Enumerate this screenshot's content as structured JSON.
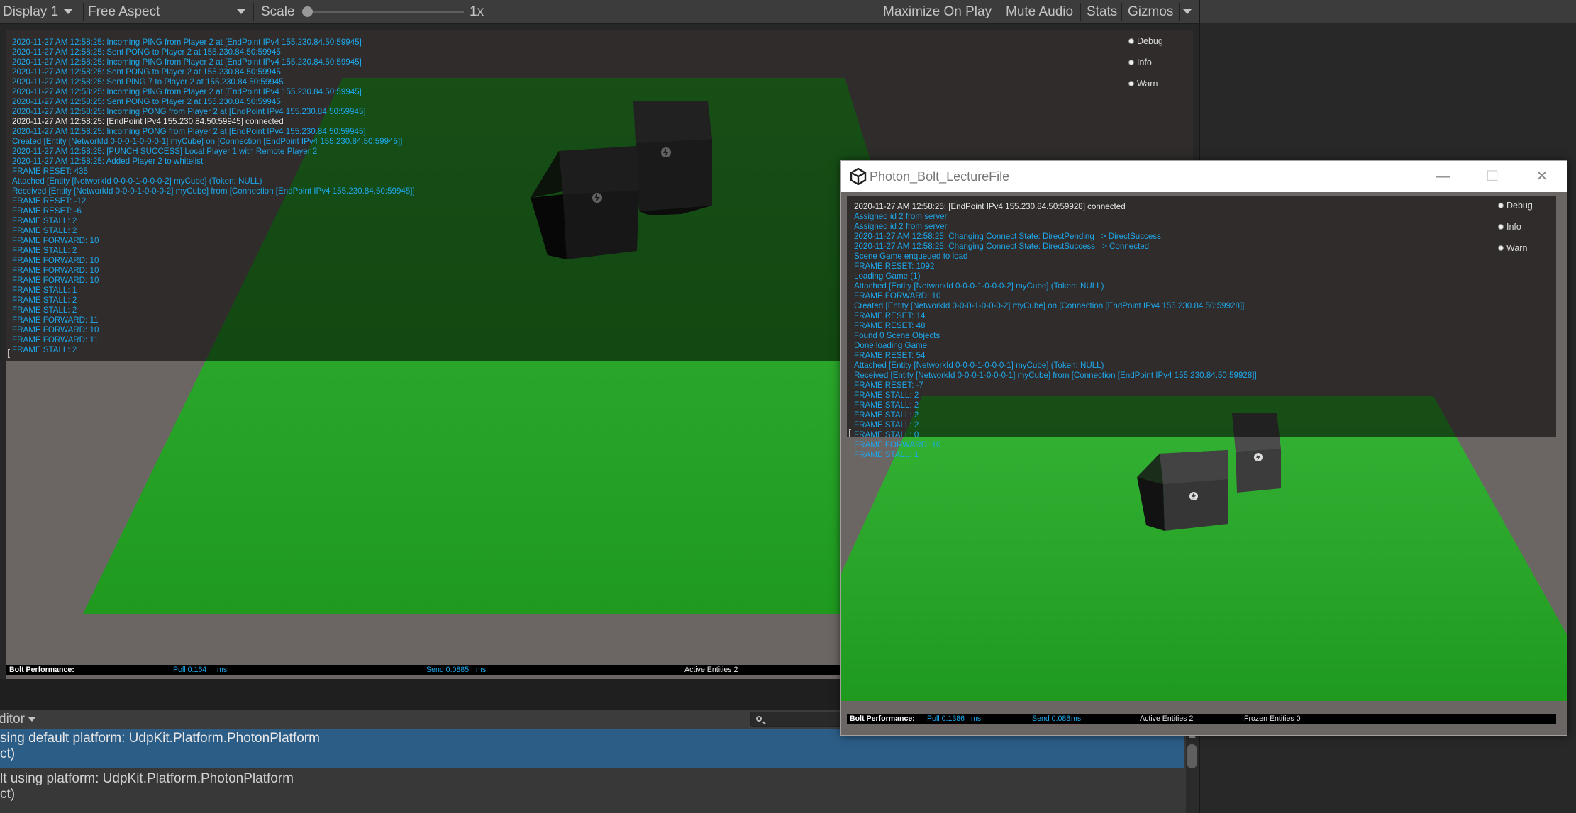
{
  "toolbar": {
    "display": "Display 1",
    "aspect": "Free Aspect",
    "scale_label": "Scale",
    "scale_value": "1x",
    "scale_fraction": 0.0,
    "maximize": "Maximize On Play",
    "mute": "Mute Audio",
    "stats": "Stats",
    "gizmos": "Gizmos"
  },
  "main_game": {
    "log_levels": [
      "Debug",
      "Info",
      "Warn"
    ],
    "log": [
      {
        "text": "2020-11-27 AM 12:58:25: Incoming PING from Player 2 at [EndPoint IPv4 155.230.84.50:59945]",
        "color": "blue"
      },
      {
        "text": "2020-11-27 AM 12:58:25: Sent PONG to Player 2 at 155.230.84.50:59945",
        "color": "blue"
      },
      {
        "text": "2020-11-27 AM 12:58:25: Incoming PING from Player 2 at [EndPoint IPv4 155.230.84.50:59945]",
        "color": "blue"
      },
      {
        "text": "2020-11-27 AM 12:58:25: Sent PONG to Player 2 at 155.230.84.50:59945",
        "color": "blue"
      },
      {
        "text": "2020-11-27 AM 12:58:25: Sent PING 7 to Player 2 at 155.230.84.50:59945",
        "color": "blue"
      },
      {
        "text": "2020-11-27 AM 12:58:25: Incoming PING from Player 2 at [EndPoint IPv4 155.230.84.50:59945]",
        "color": "blue"
      },
      {
        "text": "2020-11-27 AM 12:58:25: Sent PONG to Player 2 at 155.230.84.50:59945",
        "color": "blue"
      },
      {
        "text": "2020-11-27 AM 12:58:25: Incoming PONG from Player 2 at [EndPoint IPv4 155.230.84.50:59945]",
        "color": "blue"
      },
      {
        "text": "2020-11-27 AM 12:58:25: [EndPoint IPv4 155.230.84.50:59945] connected",
        "color": "white"
      },
      {
        "text": "2020-11-27 AM 12:58:25: Incoming PONG from Player 2 at [EndPoint IPv4 155.230.84.50:59945]",
        "color": "blue"
      },
      {
        "text": "Created [Entity [NetworkId 0-0-0-1-0-0-0-1] myCube] on [Connection [EndPoint IPv4 155.230.84.50:59945]]",
        "color": "blue"
      },
      {
        "text": "2020-11-27 AM 12:58:25: [PUNCH SUCCESS] Local Player 1 with Remote Player 2",
        "color": "blue"
      },
      {
        "text": "2020-11-27 AM 12:58:25: Added Player 2 to whitelist",
        "color": "blue"
      },
      {
        "text": "FRAME RESET: 435",
        "color": "blue"
      },
      {
        "text": "Attached [Entity [NetworkId 0-0-0-1-0-0-0-2] myCube] (Token: NULL)",
        "color": "blue"
      },
      {
        "text": "Received [Entity [NetworkId 0-0-0-1-0-0-0-2] myCube] from [Connection [EndPoint IPv4 155.230.84.50:59945]]",
        "color": "blue"
      },
      {
        "text": "FRAME RESET: -12",
        "color": "blue"
      },
      {
        "text": "FRAME RESET: -6",
        "color": "blue"
      },
      {
        "text": "FRAME STALL: 2",
        "color": "blue"
      },
      {
        "text": "FRAME STALL: 2",
        "color": "blue"
      },
      {
        "text": "FRAME FORWARD: 10",
        "color": "blue"
      },
      {
        "text": "FRAME STALL: 2",
        "color": "blue"
      },
      {
        "text": "FRAME FORWARD: 10",
        "color": "blue"
      },
      {
        "text": "FRAME FORWARD: 10",
        "color": "blue"
      },
      {
        "text": "FRAME FORWARD: 10",
        "color": "blue"
      },
      {
        "text": "FRAME STALL: 1",
        "color": "blue"
      },
      {
        "text": "FRAME STALL: 2",
        "color": "blue"
      },
      {
        "text": "FRAME STALL: 2",
        "color": "blue"
      },
      {
        "text": "FRAME FORWARD: 11",
        "color": "blue"
      },
      {
        "text": "FRAME FORWARD: 10",
        "color": "blue"
      },
      {
        "text": "FRAME FORWARD: 11",
        "color": "blue"
      },
      {
        "text": "FRAME STALL: 2",
        "color": "blue"
      }
    ],
    "perf": {
      "label": "Bolt Performance:",
      "poll": "Poll 0.164",
      "poll_unit": "ms",
      "send": "Send 0.0885",
      "send_unit": "ms",
      "active": "Active Entities 2"
    }
  },
  "player_window": {
    "title": "Photon_Bolt_LectureFile",
    "minimize": "—",
    "maximize": "☐",
    "close": "✕",
    "log_levels": [
      "Debug",
      "Info",
      "Warn"
    ],
    "log": [
      {
        "text": "2020-11-27 AM 12:58:25: [EndPoint IPv4 155.230.84.50:59928] connected",
        "color": "white"
      },
      {
        "text": "Assigned id 2 from server",
        "color": "blue"
      },
      {
        "text": "Assigned id 2 from server",
        "color": "blue"
      },
      {
        "text": "2020-11-27 AM 12:58:25: Changing Connect State: DirectPending => DirectSuccess",
        "color": "blue"
      },
      {
        "text": "2020-11-27 AM 12:58:25: Changing Connect State: DirectSuccess => Connected",
        "color": "blue"
      },
      {
        "text": "Scene Game enqueued to load",
        "color": "blue"
      },
      {
        "text": "FRAME RESET: 1092",
        "color": "blue"
      },
      {
        "text": "Loading Game (1)",
        "color": "blue"
      },
      {
        "text": "Attached [Entity [NetworkId 0-0-0-1-0-0-0-2] myCube] (Token: NULL)",
        "color": "blue"
      },
      {
        "text": "FRAME FORWARD: 10",
        "color": "blue"
      },
      {
        "text": "Created [Entity [NetworkId 0-0-0-1-0-0-0-2] myCube] on [Connection [EndPoint IPv4 155.230.84.50:59928]]",
        "color": "blue"
      },
      {
        "text": "FRAME RESET: 14",
        "color": "blue"
      },
      {
        "text": "FRAME RESET: 48",
        "color": "blue"
      },
      {
        "text": "Found 0 Scene Objects",
        "color": "blue"
      },
      {
        "text": "Done loading Game",
        "color": "blue"
      },
      {
        "text": "FRAME RESET: 54",
        "color": "blue"
      },
      {
        "text": "Attached [Entity [NetworkId 0-0-0-1-0-0-0-1] myCube] (Token: NULL)",
        "color": "blue"
      },
      {
        "text": "Received [Entity [NetworkId 0-0-0-1-0-0-0-1] myCube] from [Connection [EndPoint IPv4 155.230.84.50:59928]]",
        "color": "blue"
      },
      {
        "text": "FRAME RESET: -7",
        "color": "blue"
      },
      {
        "text": "FRAME STALL: 2",
        "color": "blue"
      },
      {
        "text": "FRAME STALL: 2",
        "color": "blue"
      },
      {
        "text": "FRAME STALL: 2",
        "color": "blue"
      },
      {
        "text": "FRAME STALL: 2",
        "color": "blue"
      },
      {
        "text": "FRAME STALL: 0",
        "color": "blue"
      },
      {
        "text": "FRAME FORWARD: 10",
        "color": "blue"
      },
      {
        "text": "FRAME STALL: 1",
        "color": "blue"
      }
    ],
    "perf": {
      "label": "Bolt Performance:",
      "poll": "Poll 0.1386",
      "poll_unit": "ms",
      "send": "Send 0.088",
      "send_unit": "ms",
      "active": "Active Entities 2",
      "frozen": "Frozen Entities 0"
    }
  },
  "console": {
    "mode_label": "ditor",
    "entries": [
      {
        "line1": "sing default platform: UdpKit.Platform.PhotonPlatform",
        "line2": "ct)",
        "selected": true
      },
      {
        "line1": "lt using platform: UdpKit.Platform.PhotonPlatform",
        "line2": "ct)",
        "selected": false
      }
    ]
  },
  "colors": {
    "log_blue": "#1ea7ea",
    "log_white": "#e6e6e6",
    "ground_green": "#26a626",
    "floor_gray": "#6b6563",
    "selection_blue": "#2c5d87"
  }
}
